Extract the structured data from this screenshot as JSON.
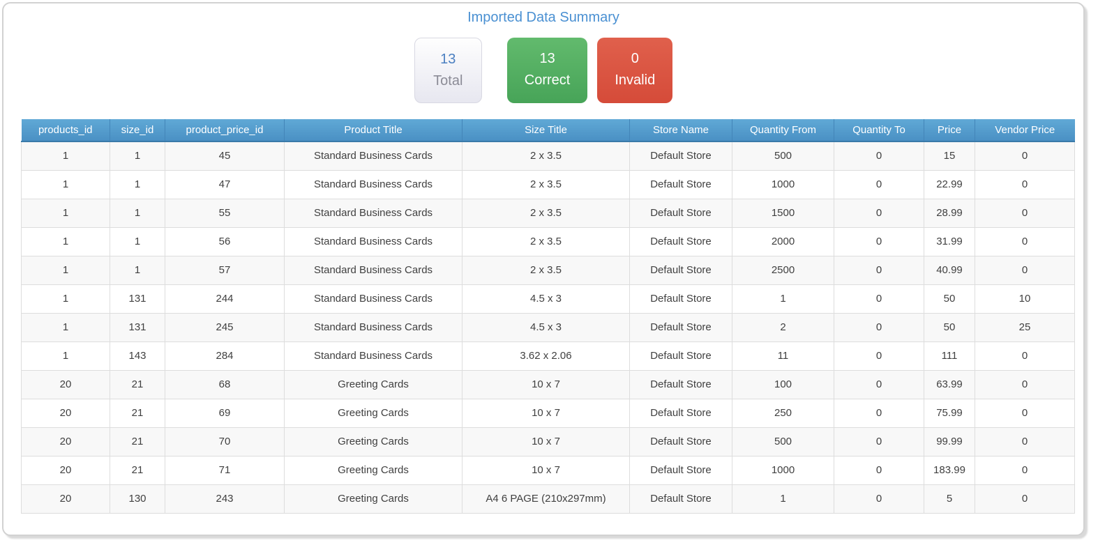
{
  "page": {
    "title": "Imported Data Summary"
  },
  "summary": {
    "total": {
      "value": "13",
      "label": "Total"
    },
    "correct": {
      "value": "13",
      "label": "Correct"
    },
    "invalid": {
      "value": "0",
      "label": "Invalid"
    }
  },
  "colors": {
    "title_blue": "#4a90d2",
    "table_header_blue_top": "#60a9d6",
    "table_header_blue_bottom": "#4a90c4",
    "correct_green": "#52af62",
    "invalid_red": "#d9534f",
    "total_value_blue": "#4a7fc1",
    "total_label_gray": "#8b8b96",
    "row_stripe_gray": "#f8f8f8",
    "cell_border_gray": "#dddddd"
  },
  "table": {
    "columns": [
      "products_id",
      "size_id",
      "product_price_id",
      "Product Title",
      "Size Title",
      "Store Name",
      "Quantity From",
      "Quantity To",
      "Price",
      "Vendor Price"
    ],
    "rows": [
      [
        "1",
        "1",
        "45",
        "Standard Business Cards",
        "2 x 3.5",
        "Default Store",
        "500",
        "0",
        "15",
        "0"
      ],
      [
        "1",
        "1",
        "47",
        "Standard Business Cards",
        "2 x 3.5",
        "Default Store",
        "1000",
        "0",
        "22.99",
        "0"
      ],
      [
        "1",
        "1",
        "55",
        "Standard Business Cards",
        "2 x 3.5",
        "Default Store",
        "1500",
        "0",
        "28.99",
        "0"
      ],
      [
        "1",
        "1",
        "56",
        "Standard Business Cards",
        "2 x 3.5",
        "Default Store",
        "2000",
        "0",
        "31.99",
        "0"
      ],
      [
        "1",
        "1",
        "57",
        "Standard Business Cards",
        "2 x 3.5",
        "Default Store",
        "2500",
        "0",
        "40.99",
        "0"
      ],
      [
        "1",
        "131",
        "244",
        "Standard Business Cards",
        "4.5 x 3",
        "Default Store",
        "1",
        "0",
        "50",
        "10"
      ],
      [
        "1",
        "131",
        "245",
        "Standard Business Cards",
        "4.5 x 3",
        "Default Store",
        "2",
        "0",
        "50",
        "25"
      ],
      [
        "1",
        "143",
        "284",
        "Standard Business Cards",
        "3.62 x 2.06",
        "Default Store",
        "11",
        "0",
        "111",
        "0"
      ],
      [
        "20",
        "21",
        "68",
        "Greeting Cards",
        "10 x 7",
        "Default Store",
        "100",
        "0",
        "63.99",
        "0"
      ],
      [
        "20",
        "21",
        "69",
        "Greeting Cards",
        "10 x 7",
        "Default Store",
        "250",
        "0",
        "75.99",
        "0"
      ],
      [
        "20",
        "21",
        "70",
        "Greeting Cards",
        "10 x 7",
        "Default Store",
        "500",
        "0",
        "99.99",
        "0"
      ],
      [
        "20",
        "21",
        "71",
        "Greeting Cards",
        "10 x 7",
        "Default Store",
        "1000",
        "0",
        "183.99",
        "0"
      ],
      [
        "20",
        "130",
        "243",
        "Greeting Cards",
        "A4 6 PAGE (210x297mm)",
        "Default Store",
        "1",
        "0",
        "5",
        "0"
      ]
    ]
  }
}
